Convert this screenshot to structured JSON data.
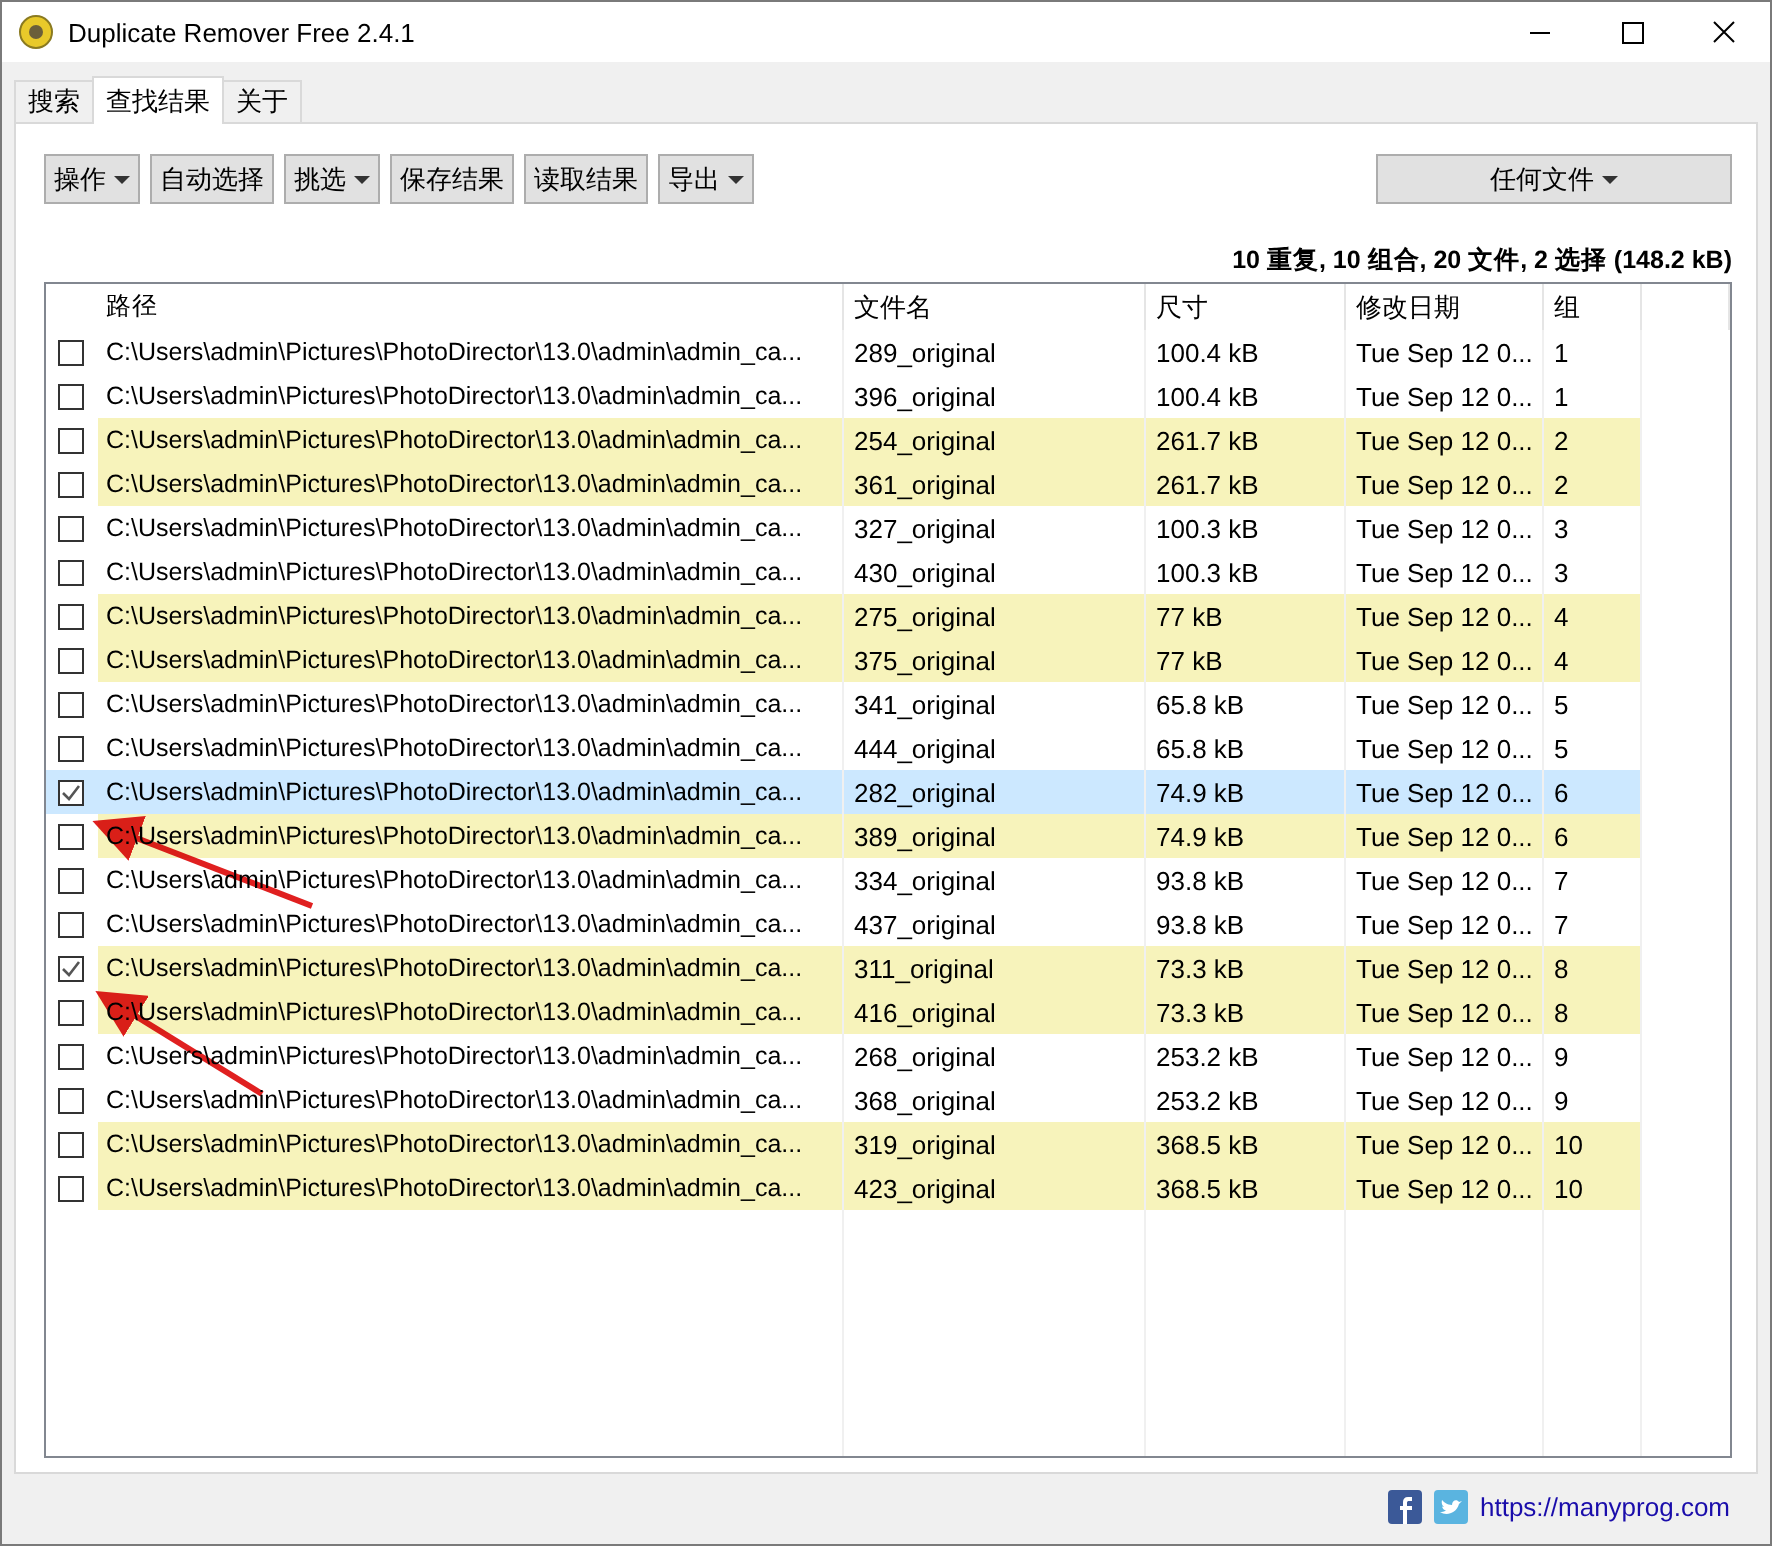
{
  "window": {
    "title": "Duplicate Remover Free 2.4.1"
  },
  "tabs": [
    {
      "label": "搜索",
      "selected": false
    },
    {
      "label": "查找结果",
      "selected": true
    },
    {
      "label": "关于",
      "selected": false
    }
  ],
  "toolbar": [
    {
      "label": "操作",
      "dropdown": true
    },
    {
      "label": "自动选择",
      "dropdown": false
    },
    {
      "label": "挑选",
      "dropdown": true
    },
    {
      "label": "保存结果",
      "dropdown": false
    },
    {
      "label": "读取结果",
      "dropdown": false
    },
    {
      "label": "导出",
      "dropdown": true
    }
  ],
  "filter": {
    "label": "任何文件",
    "dropdown": true
  },
  "summary": "10 重复, 10 组合, 20 文件, 2 选择 (148.2 kB)",
  "table": {
    "columns": [
      "路径",
      "文件名",
      "尺寸",
      "修改日期",
      "组"
    ],
    "rows": [
      {
        "path": "C:\\Users\\admin\\Pictures\\PhotoDirector\\13.0\\admin\\admin_ca...",
        "name": "289_original",
        "size": "100.4 kB",
        "date": "Tue Sep 12 0...",
        "group": "1",
        "checked": false,
        "highlighted": false,
        "selected": false
      },
      {
        "path": "C:\\Users\\admin\\Pictures\\PhotoDirector\\13.0\\admin\\admin_ca...",
        "name": "396_original",
        "size": "100.4 kB",
        "date": "Tue Sep 12 0...",
        "group": "1",
        "checked": false,
        "highlighted": false,
        "selected": false
      },
      {
        "path": "C:\\Users\\admin\\Pictures\\PhotoDirector\\13.0\\admin\\admin_ca...",
        "name": "254_original",
        "size": "261.7 kB",
        "date": "Tue Sep 12 0...",
        "group": "2",
        "checked": false,
        "highlighted": true,
        "selected": false
      },
      {
        "path": "C:\\Users\\admin\\Pictures\\PhotoDirector\\13.0\\admin\\admin_ca...",
        "name": "361_original",
        "size": "261.7 kB",
        "date": "Tue Sep 12 0...",
        "group": "2",
        "checked": false,
        "highlighted": true,
        "selected": false
      },
      {
        "path": "C:\\Users\\admin\\Pictures\\PhotoDirector\\13.0\\admin\\admin_ca...",
        "name": "327_original",
        "size": "100.3 kB",
        "date": "Tue Sep 12 0...",
        "group": "3",
        "checked": false,
        "highlighted": false,
        "selected": false
      },
      {
        "path": "C:\\Users\\admin\\Pictures\\PhotoDirector\\13.0\\admin\\admin_ca...",
        "name": "430_original",
        "size": "100.3 kB",
        "date": "Tue Sep 12 0...",
        "group": "3",
        "checked": false,
        "highlighted": false,
        "selected": false
      },
      {
        "path": "C:\\Users\\admin\\Pictures\\PhotoDirector\\13.0\\admin\\admin_ca...",
        "name": "275_original",
        "size": "77 kB",
        "date": "Tue Sep 12 0...",
        "group": "4",
        "checked": false,
        "highlighted": true,
        "selected": false
      },
      {
        "path": "C:\\Users\\admin\\Pictures\\PhotoDirector\\13.0\\admin\\admin_ca...",
        "name": "375_original",
        "size": "77 kB",
        "date": "Tue Sep 12 0...",
        "group": "4",
        "checked": false,
        "highlighted": true,
        "selected": false
      },
      {
        "path": "C:\\Users\\admin\\Pictures\\PhotoDirector\\13.0\\admin\\admin_ca...",
        "name": "341_original",
        "size": "65.8 kB",
        "date": "Tue Sep 12 0...",
        "group": "5",
        "checked": false,
        "highlighted": false,
        "selected": false
      },
      {
        "path": "C:\\Users\\admin\\Pictures\\PhotoDirector\\13.0\\admin\\admin_ca...",
        "name": "444_original",
        "size": "65.8 kB",
        "date": "Tue Sep 12 0...",
        "group": "5",
        "checked": false,
        "highlighted": false,
        "selected": false
      },
      {
        "path": "C:\\Users\\admin\\Pictures\\PhotoDirector\\13.0\\admin\\admin_ca...",
        "name": "282_original",
        "size": "74.9 kB",
        "date": "Tue Sep 12 0...",
        "group": "6",
        "checked": true,
        "highlighted": true,
        "selected": true
      },
      {
        "path": "C:\\Users\\admin\\Pictures\\PhotoDirector\\13.0\\admin\\admin_ca...",
        "name": "389_original",
        "size": "74.9 kB",
        "date": "Tue Sep 12 0...",
        "group": "6",
        "checked": false,
        "highlighted": true,
        "selected": false
      },
      {
        "path": "C:\\Users\\admin\\Pictures\\PhotoDirector\\13.0\\admin\\admin_ca...",
        "name": "334_original",
        "size": "93.8 kB",
        "date": "Tue Sep 12 0...",
        "group": "7",
        "checked": false,
        "highlighted": false,
        "selected": false
      },
      {
        "path": "C:\\Users\\admin\\Pictures\\PhotoDirector\\13.0\\admin\\admin_ca...",
        "name": "437_original",
        "size": "93.8 kB",
        "date": "Tue Sep 12 0...",
        "group": "7",
        "checked": false,
        "highlighted": false,
        "selected": false
      },
      {
        "path": "C:\\Users\\admin\\Pictures\\PhotoDirector\\13.0\\admin\\admin_ca...",
        "name": "311_original",
        "size": "73.3 kB",
        "date": "Tue Sep 12 0...",
        "group": "8",
        "checked": true,
        "highlighted": true,
        "selected": false
      },
      {
        "path": "C:\\Users\\admin\\Pictures\\PhotoDirector\\13.0\\admin\\admin_ca...",
        "name": "416_original",
        "size": "73.3 kB",
        "date": "Tue Sep 12 0...",
        "group": "8",
        "checked": false,
        "highlighted": true,
        "selected": false
      },
      {
        "path": "C:\\Users\\admin\\Pictures\\PhotoDirector\\13.0\\admin\\admin_ca...",
        "name": "268_original",
        "size": "253.2 kB",
        "date": "Tue Sep 12 0...",
        "group": "9",
        "checked": false,
        "highlighted": false,
        "selected": false
      },
      {
        "path": "C:\\Users\\admin\\Pictures\\PhotoDirector\\13.0\\admin\\admin_ca...",
        "name": "368_original",
        "size": "253.2 kB",
        "date": "Tue Sep 12 0...",
        "group": "9",
        "checked": false,
        "highlighted": false,
        "selected": false
      },
      {
        "path": "C:\\Users\\admin\\Pictures\\PhotoDirector\\13.0\\admin\\admin_ca...",
        "name": "319_original",
        "size": "368.5 kB",
        "date": "Tue Sep 12 0...",
        "group": "10",
        "checked": false,
        "highlighted": true,
        "selected": false
      },
      {
        "path": "C:\\Users\\admin\\Pictures\\PhotoDirector\\13.0\\admin\\admin_ca...",
        "name": "423_original",
        "size": "368.5 kB",
        "date": "Tue Sep 12 0...",
        "group": "10",
        "checked": false,
        "highlighted": true,
        "selected": false
      }
    ]
  },
  "footer": {
    "link": "https://manyprog.com"
  }
}
